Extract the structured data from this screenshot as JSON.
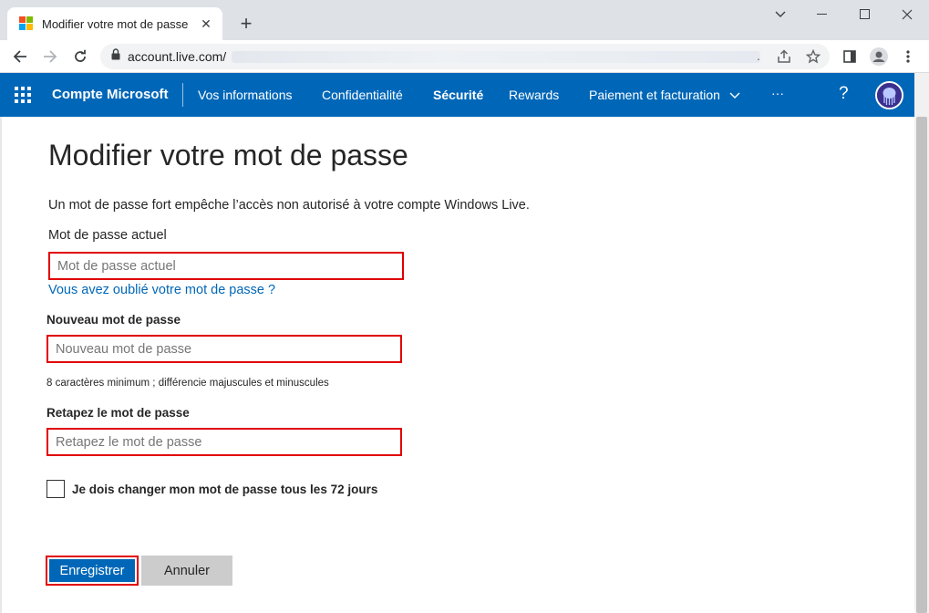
{
  "browser": {
    "tab_title": "Modifier votre mot de passe",
    "url": "account.live.com/",
    "url_trailing": "."
  },
  "nav": {
    "brand": "Compte Microsoft",
    "items": [
      {
        "label": "Vos informations",
        "active": false
      },
      {
        "label": "Confidentialité",
        "active": false
      },
      {
        "label": "Sécurité",
        "active": true
      },
      {
        "label": "Rewards",
        "active": false
      },
      {
        "label": "Paiement et facturation",
        "active": false
      },
      {
        "label": "···",
        "active": false
      }
    ],
    "help": "?"
  },
  "form": {
    "title": "Modifier votre mot de passe",
    "description": "Un mot de passe fort empêche l’accès non autorisé à votre compte Windows Live.",
    "current_label": "Mot de passe actuel",
    "current_placeholder": "Mot de passe actuel",
    "forgot_link": "Vous avez oublié votre mot de passe ?",
    "new_label": "Nouveau mot de passe",
    "new_placeholder": "Nouveau mot de passe",
    "hint": "8 caractères minimum ; différencie majuscules et minuscules",
    "retype_label": "Retapez le mot de passe",
    "retype_placeholder": "Retapez le mot de passe",
    "checkbox_label": "Je dois changer mon mot de passe tous les 72 jours",
    "checkbox_checked": false,
    "save_label": "Enregistrer",
    "cancel_label": "Annuler"
  },
  "colors": {
    "brand_blue": "#0067b8",
    "highlight_red": "#e00000"
  }
}
